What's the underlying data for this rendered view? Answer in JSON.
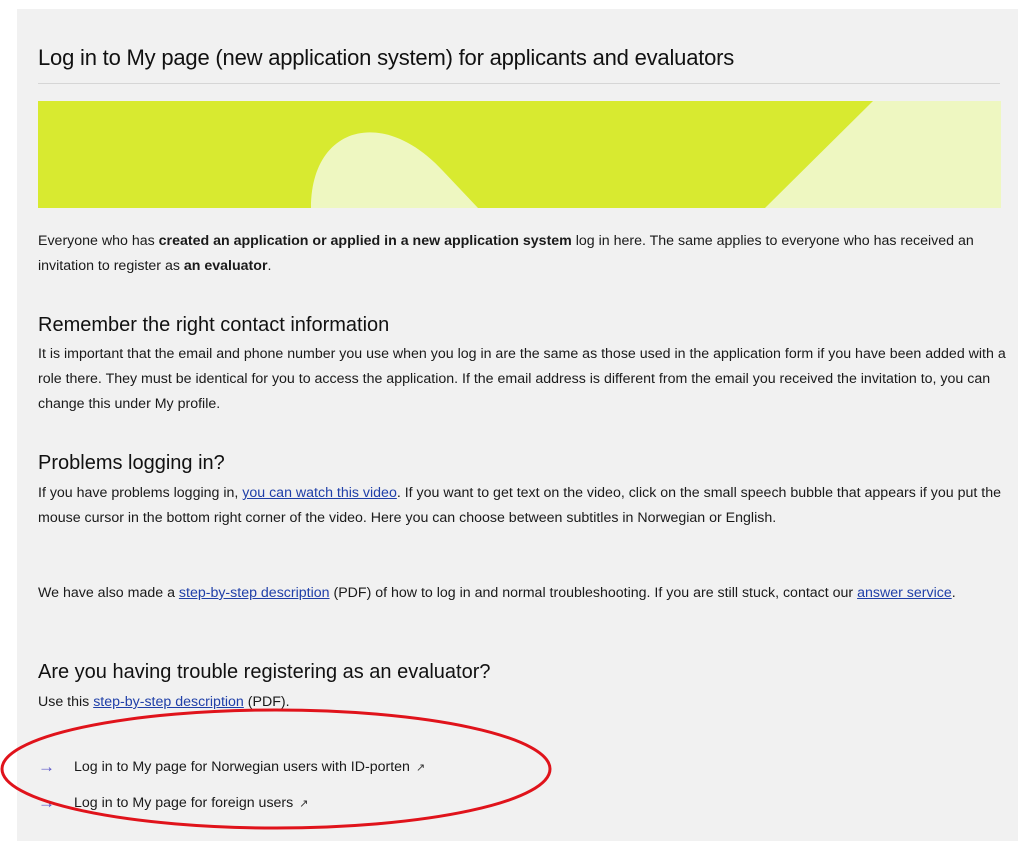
{
  "page": {
    "title": "Log in to My page (new application system) for applicants and evaluators"
  },
  "banner": {
    "background_color": "#d8ea30",
    "shape_color": "#eef7c1"
  },
  "intro": {
    "p1": "Everyone who has ",
    "b1": "created an application or applied in a new application system",
    "p2": " log in here. The same applies to everyone who has received an invitation to register as ",
    "b2": "an evaluator",
    "p3": "."
  },
  "contact": {
    "heading": "Remember the right contact information",
    "text": "It is important that the email and phone number you use when you log in are the same as those used in the application form if you have been added with a role there. They must be identical for you to access the application. If the email address is different from the email you received the invitation to, you can change this under My profile."
  },
  "problems": {
    "heading": "Problems logging in?",
    "p1_before": "If you have problems logging in, ",
    "p1_link": "you can watch this video",
    "p1_after": ". If you want to get text on the video, click on the small speech bubble that appears if you put the mouse cursor in the bottom right corner of the video. Here you can choose between subtitles in Norwegian or English.",
    "p2_before": "We have also made a ",
    "p2_link": "step-by-step description",
    "p2_middle": " (PDF) of how to log in and normal troubleshooting. If you are still stuck, contact our ",
    "p2_link2": "answer service",
    "p2_after": "."
  },
  "evaluator": {
    "heading": "Are you having trouble registering as an evaluator?",
    "before": "Use this ",
    "link": "step-by-step description",
    "after": " (PDF)."
  },
  "login_links": [
    {
      "label": "Log in to My page for Norwegian users with ID-porten"
    },
    {
      "label": "Log in to My page for foreign users"
    }
  ],
  "icons": {
    "arrow": "→",
    "external": "↗"
  },
  "annotation": {
    "circle_color": "#e0131b"
  }
}
